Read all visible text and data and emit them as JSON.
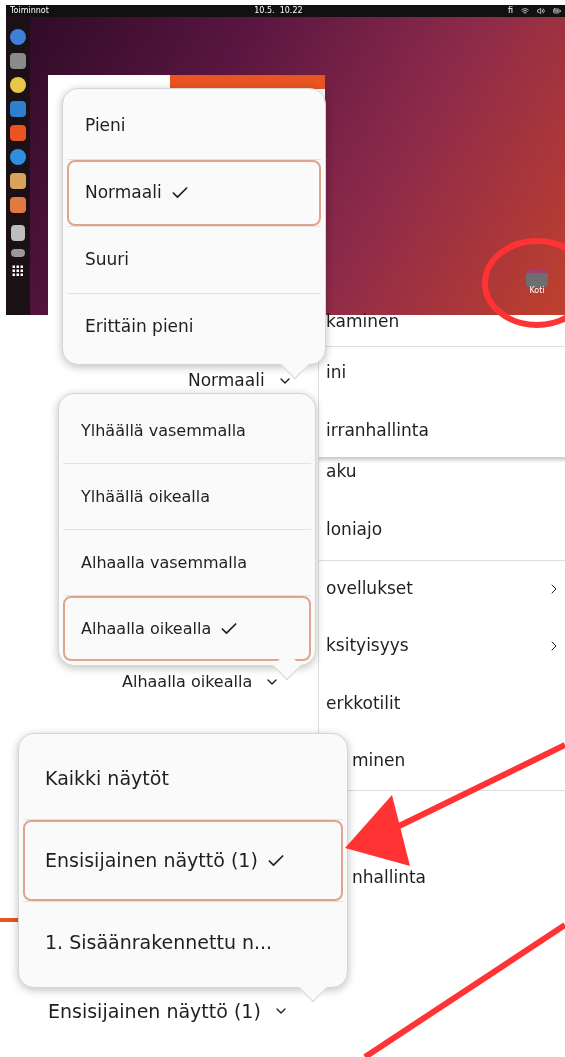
{
  "desktop": {
    "top_bar": {
      "activities": "Toiminnot",
      "clock": "10.5.  10.22",
      "input_source": "fi"
    },
    "desktop_icon": {
      "label": "Koti"
    }
  },
  "settings_list": {
    "items": [
      {
        "label": "kaminen",
        "has_submenu": false
      },
      {
        "label": "ini",
        "has_submenu": false
      },
      {
        "label": "irranhallinta",
        "has_submenu": false
      },
      {
        "label": "aku",
        "has_submenu": false
      },
      {
        "label": "loniajo",
        "has_submenu": false
      },
      {
        "label": "ovellukset",
        "has_submenu": true
      },
      {
        "label": "ksityisyys",
        "has_submenu": true
      },
      {
        "label": "erkkotilit",
        "has_submenu": false
      },
      {
        "label": "minen",
        "has_submenu": false
      },
      {
        "label": "nhallinta",
        "has_submenu": false
      }
    ]
  },
  "dropdowns": [
    {
      "value": "Normaali",
      "options": [
        {
          "label": "Pieni",
          "selected": false
        },
        {
          "label": "Normaali",
          "selected": true
        },
        {
          "label": "Suuri",
          "selected": false
        },
        {
          "label": "Erittäin pieni",
          "selected": false
        }
      ]
    },
    {
      "value": "Alhaalla oikealla",
      "options": [
        {
          "label": "Ylhäällä vasemmalla",
          "selected": false
        },
        {
          "label": "Ylhäällä oikealla",
          "selected": false
        },
        {
          "label": "Alhaalla vasemmalla",
          "selected": false
        },
        {
          "label": "Alhaalla oikealla",
          "selected": true
        }
      ]
    },
    {
      "value": "Ensisijainen näyttö (1)",
      "options": [
        {
          "label": "Kaikki näytöt",
          "selected": false
        },
        {
          "label": "Ensisijainen näyttö (1)",
          "selected": true
        },
        {
          "label": "1. Sisäänrakennettu n...",
          "selected": false
        }
      ]
    }
  ]
}
